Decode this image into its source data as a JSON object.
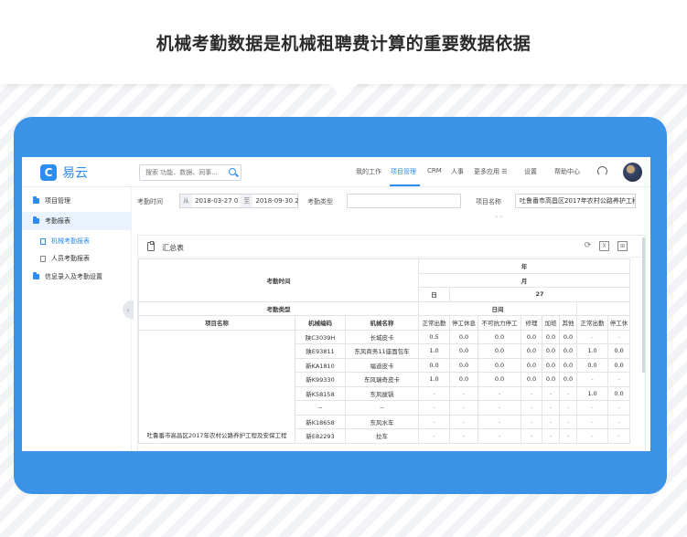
{
  "banner": {
    "title": "机械考勤数据是机械租聘费计算的重要数据依据"
  },
  "app": {
    "logo_mark": "C",
    "logo_text": "易云"
  },
  "search": {
    "placeholder": "搜索 功能、数据、同事..."
  },
  "nav": {
    "items": [
      "我的工作",
      "项目管理",
      "CRM",
      "人事",
      "更多应用 ☰",
      "设置",
      "帮助中心"
    ],
    "active": "项目管理"
  },
  "sidebar": {
    "items": [
      {
        "label": "项目管理",
        "level": "top",
        "icon": "folder-icon"
      },
      {
        "label": "考勤报表",
        "level": "top",
        "icon": "folder-icon",
        "active": true
      },
      {
        "label": "机械考勤报表",
        "level": "sub",
        "icon": "doc-icon",
        "active": true
      },
      {
        "label": "人员考勤报表",
        "level": "sub",
        "icon": "doc-icon"
      },
      {
        "label": "信息录入及考勤设置",
        "level": "top",
        "icon": "folder-icon"
      }
    ]
  },
  "filters": {
    "time_label": "考勤时间",
    "from_label": "从",
    "from_value": "2018-03-27 0",
    "to_label": "至",
    "to_value": "2018-09-30 2",
    "type_label": "考勤类型",
    "type_value": "",
    "project_label": "项目名称",
    "project_value": "吐鲁番市高昌区2017年农村公路养护工程J"
  },
  "panel": {
    "title": "汇总表"
  },
  "table": {
    "attendance_time": "考勤时间",
    "year": "年",
    "month": "月",
    "day": "日",
    "day_value": "27",
    "attendance_type": "考勤类型",
    "day_shift": "日间",
    "col_project": "项目名称",
    "col_code": "机械编码",
    "col_name": "机械名称",
    "status_cols": [
      "正常出勤",
      "停工休息",
      "不可抗力停工",
      "修理",
      "加班",
      "其他",
      "正常出勤",
      "停工休"
    ],
    "project_name": "吐鲁番市高昌区2017年农村公路养护工程及安保工程",
    "rows": [
      {
        "code": "陕C3039H",
        "name": "长城皮卡",
        "values": [
          "0.5",
          "0.0",
          "0.0",
          "0.0",
          "0.0",
          "0.0",
          "-",
          "-"
        ]
      },
      {
        "code": "陕E93811",
        "name": "东风商务11座面包车",
        "values": [
          "1.0",
          "0.0",
          "0.0",
          "0.0",
          "0.0",
          "0.0",
          "1.0",
          "0.0"
        ]
      },
      {
        "code": "新KA1810",
        "name": "福迪皮卡",
        "values": [
          "0.0",
          "0.0",
          "0.0",
          "0.0",
          "0.0",
          "0.0",
          "0.0",
          "0.0"
        ]
      },
      {
        "code": "新K99330",
        "name": "东风瑞奇皮卡",
        "values": [
          "1.0",
          "0.0",
          "0.0",
          "0.0",
          "0.0",
          "0.0",
          "-",
          "-"
        ]
      },
      {
        "code": "新K58158",
        "name": "东风拔锅",
        "values": [
          "-",
          "-",
          "-",
          "-",
          "-",
          "-",
          "1.0",
          "0.0"
        ]
      },
      {
        "code": "--",
        "name": "--",
        "values": [
          "-",
          "-",
          "-",
          "-",
          "-",
          "-",
          "-",
          "-"
        ]
      },
      {
        "code": "新K18658",
        "name": "东风水车",
        "values": [
          "-",
          "-",
          "-",
          "-",
          "-",
          "-",
          "-",
          "-"
        ]
      },
      {
        "code": "新E82293",
        "name": "拉车",
        "values": [
          "-",
          "-",
          "-",
          "-",
          "-",
          "-",
          "-",
          "-"
        ]
      }
    ]
  },
  "colors": {
    "accent": "#2d8cf0",
    "frame": "#3a93e6"
  }
}
